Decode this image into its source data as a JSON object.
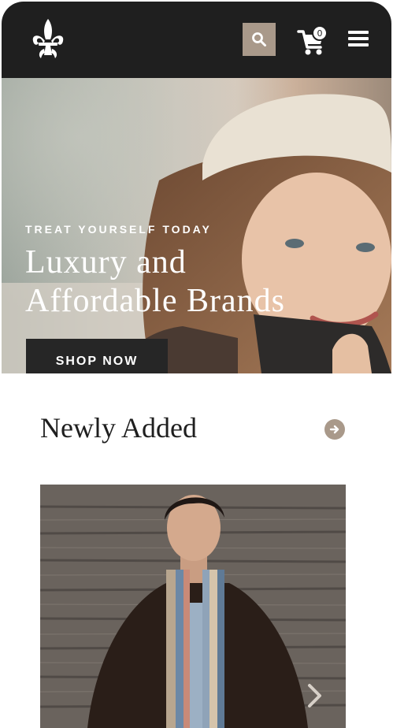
{
  "header": {
    "logo_icon": "fleur-de-lis-icon",
    "search_icon": "search-icon",
    "cart_icon": "cart-icon",
    "cart_count": "0",
    "menu_icon": "hamburger-menu-icon"
  },
  "hero": {
    "kicker": "TREAT YOURSELF TODAY",
    "title_line1": "Luxury and",
    "title_line2": "Affordable Brands",
    "cta_label": "SHOP NOW"
  },
  "newly_added": {
    "title": "Newly Added",
    "view_all_icon": "arrow-right-circle-icon",
    "next_icon": "chevron-right-icon"
  },
  "colors": {
    "header_bg": "#1f1f1f",
    "accent": "#a9998a",
    "button_dark": "#262626",
    "text_dark": "#1f1f1f"
  }
}
